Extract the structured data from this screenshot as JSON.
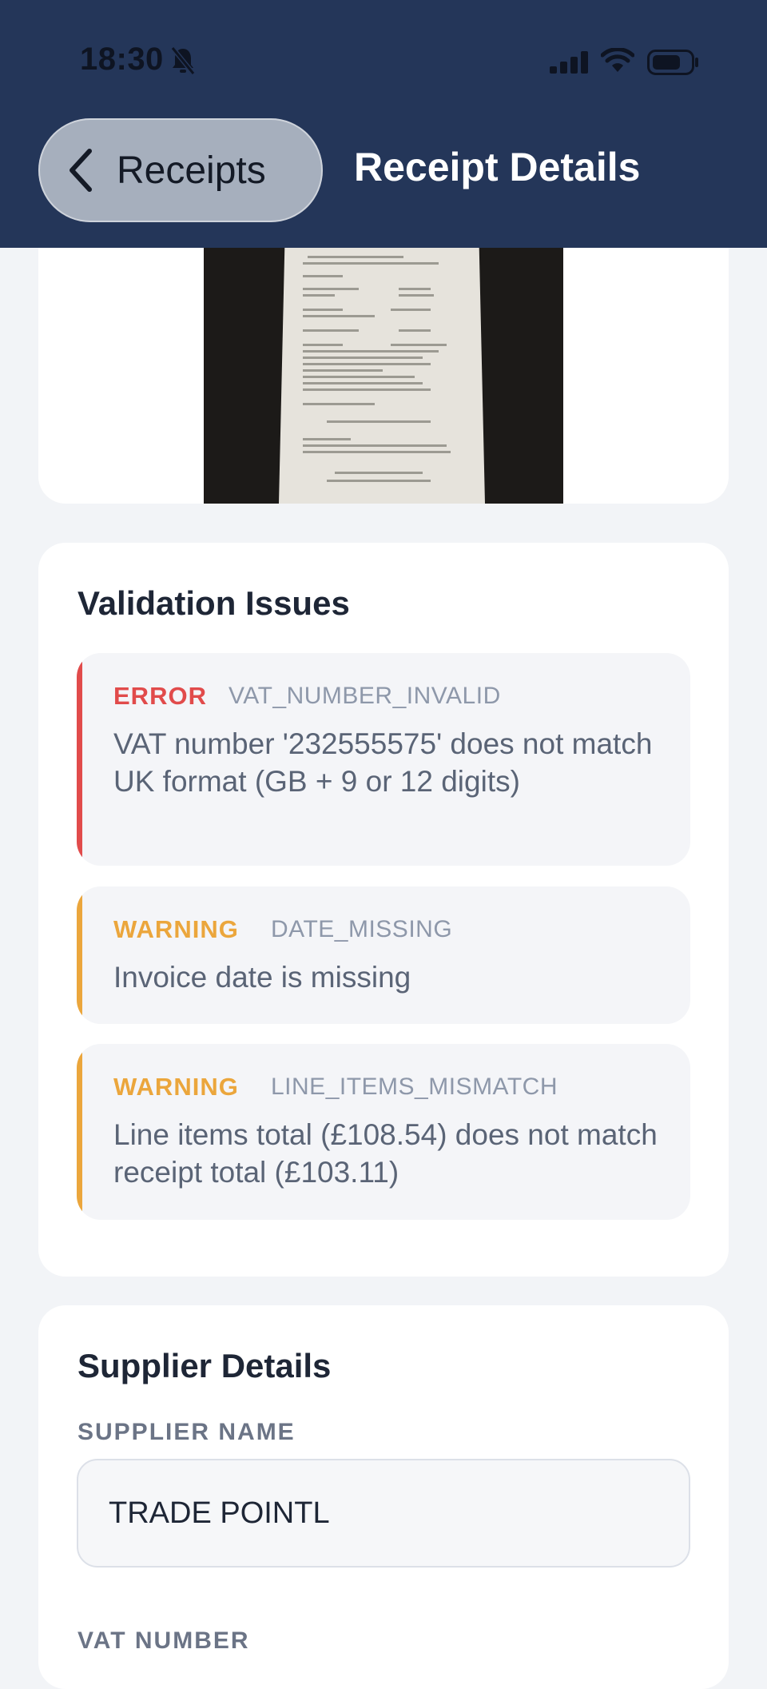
{
  "status_bar": {
    "time": "18:30"
  },
  "nav": {
    "back_label": "Receipts",
    "title": "Receipt Details"
  },
  "validation": {
    "title": "Validation Issues",
    "issues": [
      {
        "severity": "ERROR",
        "code": "VAT_NUMBER_INVALID",
        "message": "VAT number '232555575' does not match UK format (GB + 9 or 12 digits)",
        "color": "#E14B4B"
      },
      {
        "severity": "WARNING",
        "code": "DATE_MISSING",
        "message": "Invoice date is missing",
        "color": "#EBA63C"
      },
      {
        "severity": "WARNING",
        "code": "LINE_ITEMS_MISMATCH",
        "message": "Line items total (£108.54) does not match receipt total (£103.11)",
        "color": "#EBA63C"
      }
    ]
  },
  "supplier": {
    "title": "Supplier Details",
    "name_label": "SUPPLIER NAME",
    "name_value": "TRADE POINTL",
    "vat_label": "VAT NUMBER"
  }
}
